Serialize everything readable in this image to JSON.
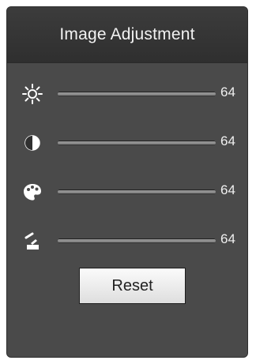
{
  "panel": {
    "title": "Image Adjustment"
  },
  "sliders": [
    {
      "id": "brightness",
      "icon": "brightness-icon",
      "value_text": "64",
      "value": 64,
      "max": 100
    },
    {
      "id": "contrast",
      "icon": "contrast-icon",
      "value_text": "64",
      "value": 64,
      "max": 100
    },
    {
      "id": "saturation",
      "icon": "saturation-icon",
      "value_text": "64",
      "value": 64,
      "max": 100
    },
    {
      "id": "hue",
      "icon": "hue-icon",
      "value_text": "64",
      "value": 64,
      "max": 100
    }
  ],
  "buttons": {
    "reset_label": "Reset"
  },
  "colors": {
    "panel_bg": "#4a4a4a",
    "header_bg": "#333333",
    "track": "#333333",
    "fill": "#8a8a8a",
    "icon": "#ffffff",
    "text": "#f0f0f0"
  }
}
